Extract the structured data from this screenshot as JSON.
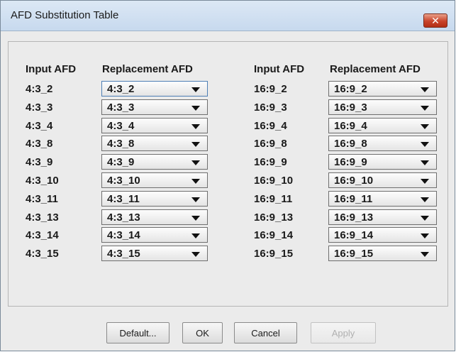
{
  "window": {
    "title": "AFD Substitution Table",
    "close_symbol": "✕"
  },
  "headers": {
    "left_input": "Input AFD",
    "left_replacement": "Replacement AFD",
    "right_input": "Input AFD",
    "right_replacement": "Replacement AFD"
  },
  "left_rows": [
    {
      "input": "4:3_2",
      "replacement": "4:3_2"
    },
    {
      "input": "4:3_3",
      "replacement": "4:3_3"
    },
    {
      "input": "4:3_4",
      "replacement": "4:3_4"
    },
    {
      "input": "4:3_8",
      "replacement": "4:3_8"
    },
    {
      "input": "4:3_9",
      "replacement": "4:3_9"
    },
    {
      "input": "4:3_10",
      "replacement": "4:3_10"
    },
    {
      "input": "4:3_11",
      "replacement": "4:3_11"
    },
    {
      "input": "4:3_13",
      "replacement": "4:3_13"
    },
    {
      "input": "4:3_14",
      "replacement": "4:3_14"
    },
    {
      "input": "4:3_15",
      "replacement": "4:3_15"
    }
  ],
  "right_rows": [
    {
      "input": "16:9_2",
      "replacement": "16:9_2"
    },
    {
      "input": "16:9_3",
      "replacement": "16:9_3"
    },
    {
      "input": "16:9_4",
      "replacement": "16:9_4"
    },
    {
      "input": "16:9_8",
      "replacement": "16:9_8"
    },
    {
      "input": "16:9_9",
      "replacement": "16:9_9"
    },
    {
      "input": "16:9_10",
      "replacement": "16:9_10"
    },
    {
      "input": "16:9_11",
      "replacement": "16:9_11"
    },
    {
      "input": "16:9_13",
      "replacement": "16:9_13"
    },
    {
      "input": "16:9_14",
      "replacement": "16:9_14"
    },
    {
      "input": "16:9_15",
      "replacement": "16:9_15"
    }
  ],
  "buttons": {
    "default": "Default...",
    "ok": "OK",
    "cancel": "Cancel",
    "apply": "Apply"
  }
}
